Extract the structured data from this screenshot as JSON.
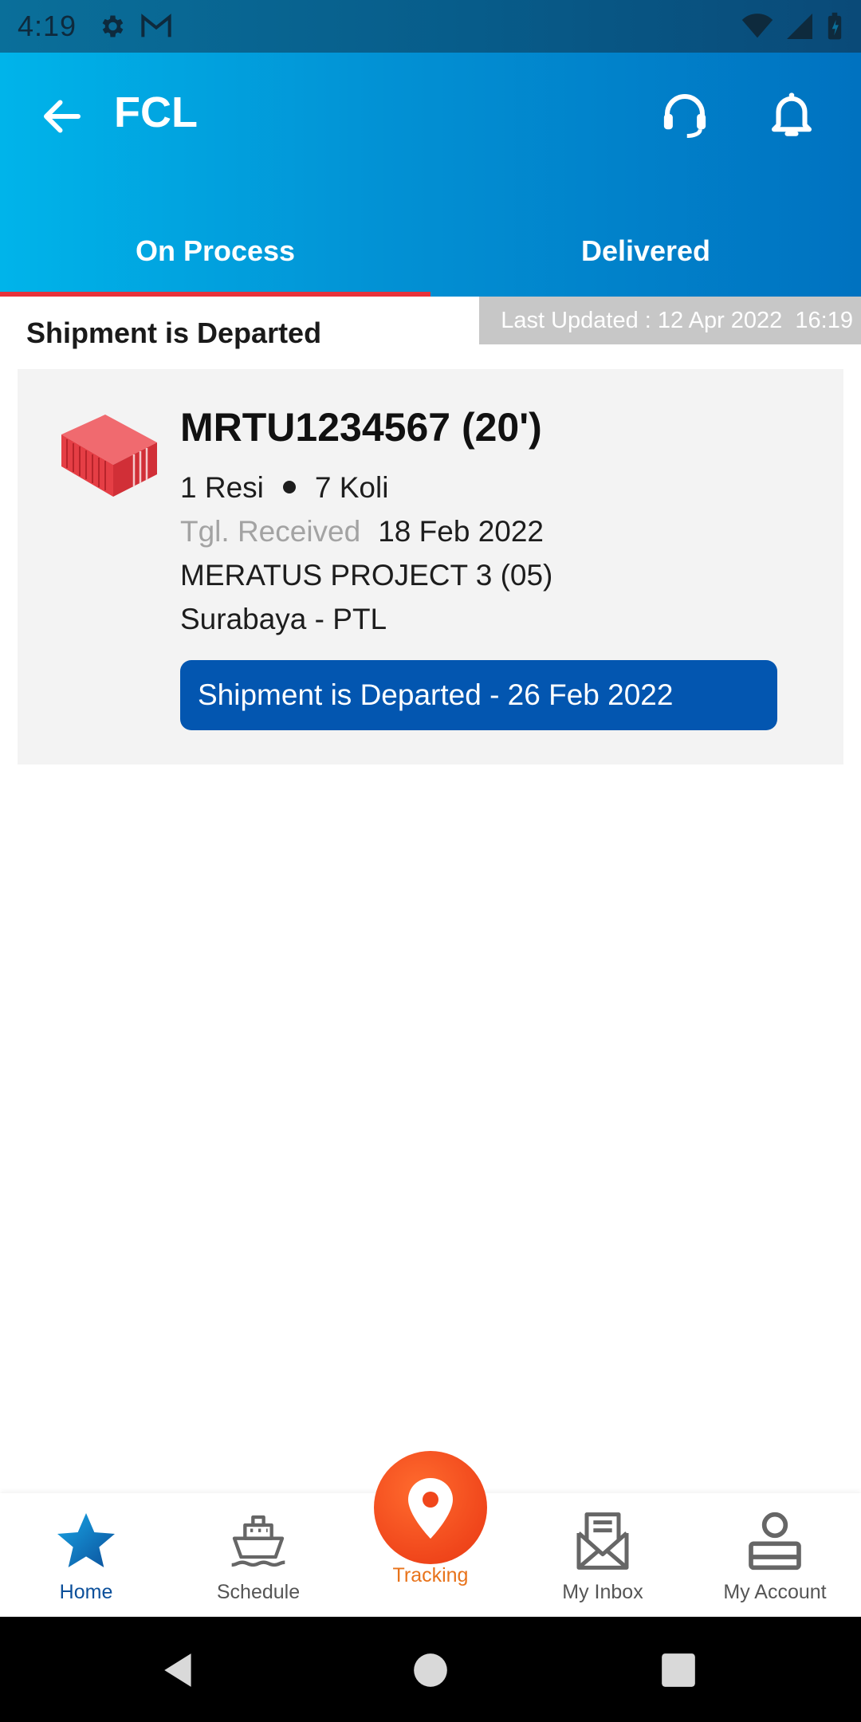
{
  "status_bar": {
    "time": "4:19"
  },
  "header": {
    "title": "FCL",
    "tabs": [
      {
        "label": "On Process",
        "active": true
      },
      {
        "label": "Delivered",
        "active": false
      }
    ]
  },
  "section": {
    "title": "Shipment is Departed",
    "last_updated": "Last Updated : 12 Apr 2022  16:19"
  },
  "shipment": {
    "container": "MRTU1234567 (20')",
    "resi": "1 Resi",
    "koli": "7 Koli",
    "received_label": "Tgl. Received",
    "received_date": "18 Feb 2022",
    "vessel": "MERATUS PROJECT 3 (05)",
    "route": "Surabaya - PTL",
    "status": "Shipment is Departed - 26 Feb 2022"
  },
  "bottom_nav": {
    "home": "Home",
    "schedule": "Schedule",
    "tracking": "Tracking",
    "inbox": "My Inbox",
    "account": "My Account"
  },
  "colors": {
    "accent_blue": "#0356b0",
    "header_gradient_start": "#00b4ea",
    "header_gradient_end": "#0072c0",
    "tab_indicator": "#e8323a",
    "tracking_orange": "#f0461b",
    "container_red": "#e53e45"
  },
  "icons": [
    "settings-icon",
    "gmail-icon",
    "wifi-icon",
    "signal-icon",
    "battery-icon",
    "back-arrow-icon",
    "headset-icon",
    "bell-icon",
    "container-icon",
    "star-icon",
    "ship-icon",
    "location-pin-icon",
    "inbox-icon",
    "account-icon"
  ]
}
